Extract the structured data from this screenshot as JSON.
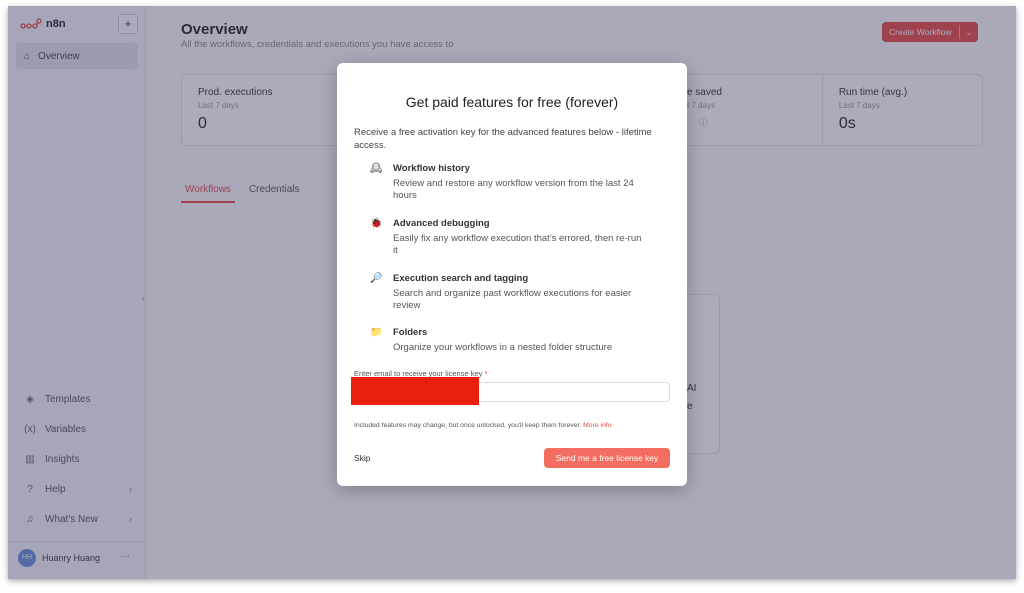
{
  "app": {
    "name": "n8n"
  },
  "sidebar": {
    "overview": "Overview",
    "bottom_items": [
      {
        "label": "Templates",
        "icon": "templates-icon"
      },
      {
        "label": "Variables",
        "icon": "variables-icon"
      },
      {
        "label": "Insights",
        "icon": "insights-icon"
      },
      {
        "label": "Help",
        "icon": "help-icon"
      },
      {
        "label": "What's New",
        "icon": "bell-icon"
      }
    ],
    "user": {
      "name": "Huanry Huang"
    }
  },
  "main": {
    "title": "Overview",
    "subtitle": "All the workflows, credentials and executions you have access to",
    "create_button": "Create Workflow",
    "stats": [
      {
        "title": "Prod. executions",
        "sub": "Last 7 days",
        "value": "0"
      },
      {
        "title": "me saved",
        "sub": "ast 7 days",
        "value": ""
      },
      {
        "title": "Run time (avg.)",
        "sub": "Last 7 days",
        "value": "0s"
      }
    ],
    "tabs": [
      "Workflows",
      "Credentials"
    ],
    "card_partial": [
      "AI",
      "e"
    ]
  },
  "modal": {
    "title": "Get paid features for free (forever)",
    "intro": "Receive a free activation key for the advanced features below - lifetime access.",
    "features": [
      {
        "icon": "🕰",
        "title": "Workflow history",
        "desc": "Review and restore any workflow version from the last 24 hours"
      },
      {
        "icon": "🐞",
        "title": "Advanced debugging",
        "desc": "Easily fix any workflow execution that's errored, then re-run it"
      },
      {
        "icon": "🔎",
        "title": "Execution search and tagging",
        "desc": "Search and organize past workflow executions for easier review"
      },
      {
        "icon": "📁",
        "title": "Folders",
        "desc": "Organize your workflows in a nested folder structure"
      }
    ],
    "email_label": "Enter email to receive your license key",
    "email_required_mark": "*",
    "email_value": "",
    "disclaimer": "Included features may change, but once unlocked, you'll keep them forever.",
    "more_info": "More info",
    "skip": "Skip",
    "send_button": "Send me a free license key"
  },
  "colors": {
    "accent": "#ea4b41",
    "send_button": "#f36e60",
    "overlay": "#37375f"
  }
}
